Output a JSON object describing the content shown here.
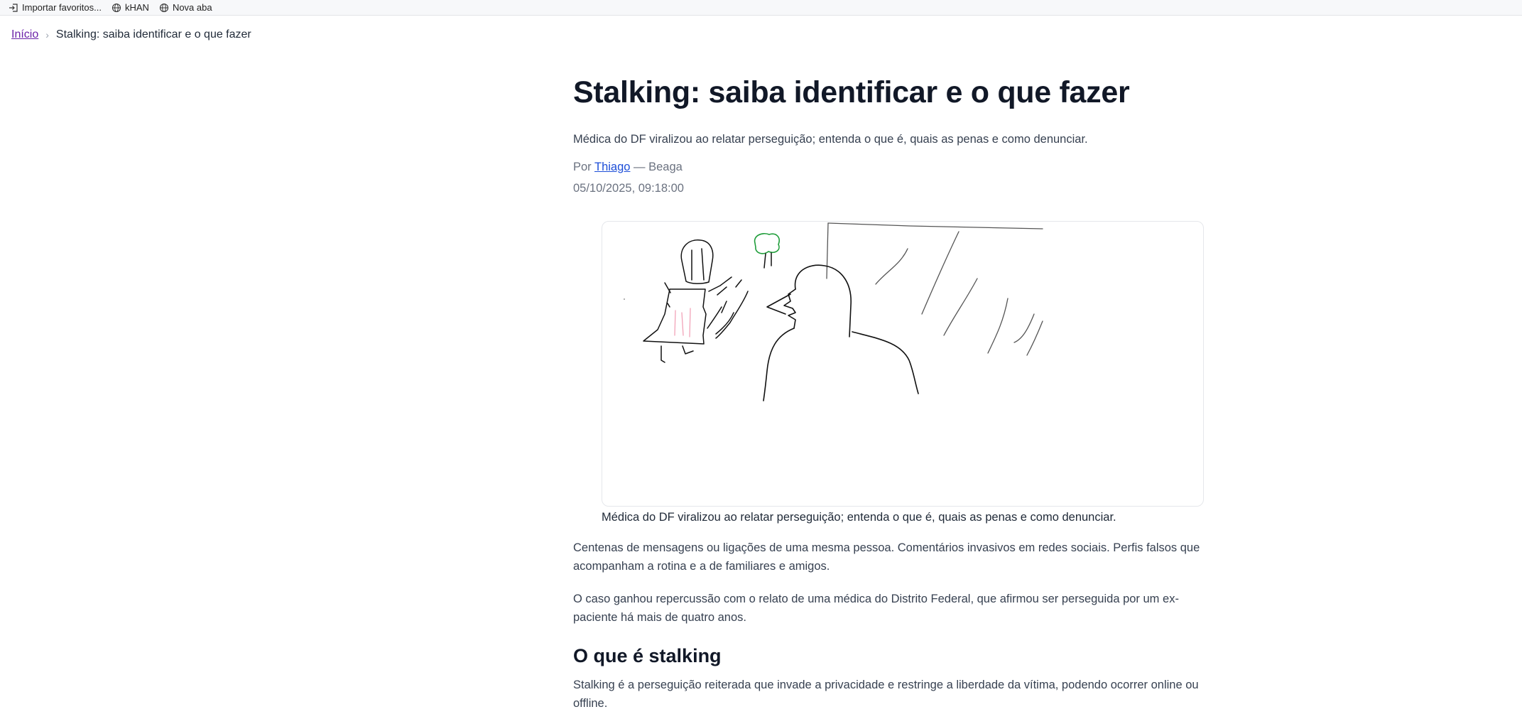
{
  "bookmarks": [
    {
      "label": "Importar favoritos...",
      "icon": "import-icon"
    },
    {
      "label": "kHAN",
      "icon": "globe-icon"
    },
    {
      "label": "Nova aba",
      "icon": "globe-icon"
    }
  ],
  "breadcrumb": {
    "home": "Início",
    "current": "Stalking: saiba identificar e o que fazer"
  },
  "article": {
    "title": "Stalking: saiba identificar e o que fazer",
    "subtitle": "Médica do DF viralizou ao relatar perseguição; entenda o que é, quais as penas e como denunciar.",
    "by_prefix": "Por",
    "author": "Thiago",
    "source": "— Beaga",
    "date": "05/10/2025, 09:18:00",
    "image_caption": "Médica do DF viralizou ao relatar perseguição; entenda o que é, quais as penas e como denunciar.",
    "paragraphs": [
      "Centenas de mensagens ou ligações de uma mesma pessoa. Comentários invasivos em redes sociais. Perfis falsos que acompanham a rotina e a de familiares e amigos.",
      "O caso ganhou repercussão com o relato de uma médica do Distrito Federal, que afirmou ser perseguida por um ex-paciente há mais de quatro anos."
    ],
    "section_heading": "O que é stalking",
    "section_paragraph": "Stalking é a perseguição reiterada que invade a privacidade e restringe a liberdade da vítima, podendo ocorrer online ou offline."
  }
}
